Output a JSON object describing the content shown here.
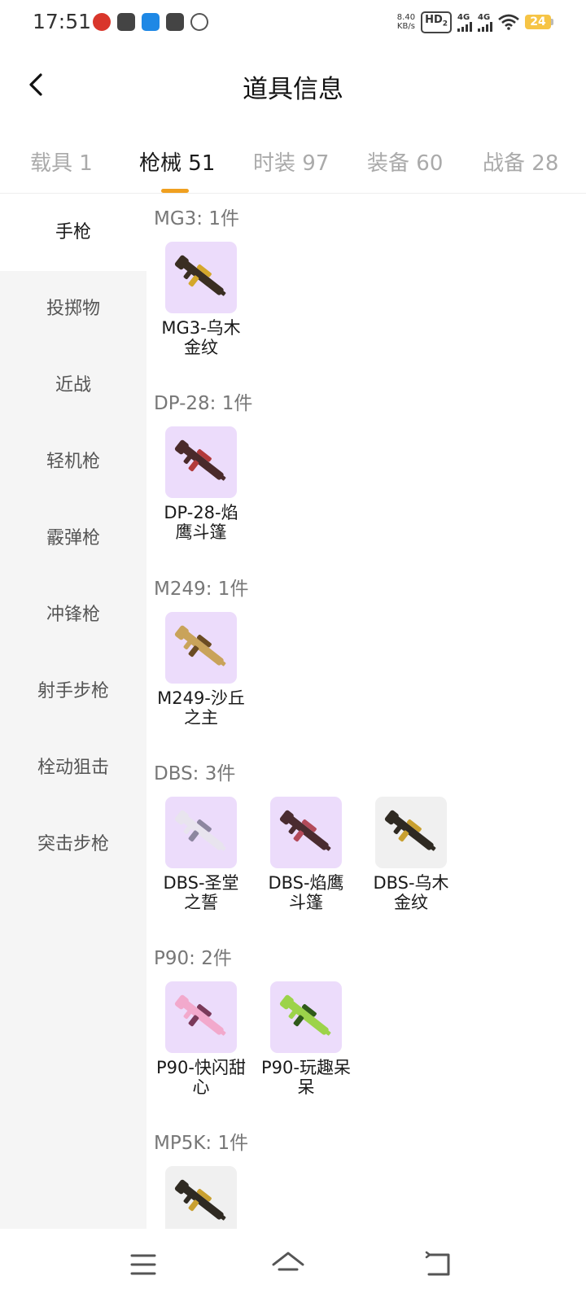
{
  "status_bar": {
    "time": "17:51",
    "net_speed_value": "8.40",
    "net_speed_unit": "KB/s",
    "hd_label": "HD",
    "hd_sub": "2",
    "signal_1_label": "4G",
    "signal_2_label": "4G",
    "battery_level": "24",
    "left_icons": [
      "app-badge-icon",
      "scissors-app-icon",
      "blue-app-icon",
      "mail-box-icon",
      "leaf-icon"
    ],
    "right_icons": [
      "wifi-icon",
      "battery-icon"
    ]
  },
  "header": {
    "title": "道具信息",
    "back_icon": "chevron-left-icon"
  },
  "tabs": [
    {
      "label": "载具",
      "count": "1"
    },
    {
      "label": "枪械",
      "count": "51",
      "active": true
    },
    {
      "label": "时装",
      "count": "97"
    },
    {
      "label": "装备",
      "count": "60"
    },
    {
      "label": "战备",
      "count": "28"
    }
  ],
  "accent_color": "#f0a020",
  "sidebar": {
    "items": [
      {
        "label": "手枪",
        "active": true
      },
      {
        "label": "投掷物"
      },
      {
        "label": "近战"
      },
      {
        "label": "轻机枪"
      },
      {
        "label": "霰弹枪"
      },
      {
        "label": "冲锋枪"
      },
      {
        "label": "射手步枪"
      },
      {
        "label": "栓动狙击"
      },
      {
        "label": "突击步枪"
      }
    ]
  },
  "groups": [
    {
      "title": "MG3: 1件",
      "items": [
        {
          "line1": "MG3-乌木",
          "line2": "金纹",
          "tile_color": "#ecdcfb",
          "icon": "mg3-ebony-gold-gun-icon",
          "gun_color": "#3a2e22",
          "accent": "#d4a72c"
        }
      ]
    },
    {
      "title": "DP-28: 1件",
      "items": [
        {
          "line1": "DP-28-焰",
          "line2": "鹰斗篷",
          "tile_color": "#ecdcfb",
          "icon": "dp28-flame-eagle-gun-icon",
          "gun_color": "#4a2a2a",
          "accent": "#b23a3a"
        }
      ]
    },
    {
      "title": "M249: 1件",
      "items": [
        {
          "line1": "M249-沙丘",
          "line2": "之主",
          "tile_color": "#ecdcfb",
          "icon": "m249-dune-lord-gun-icon",
          "gun_color": "#c9a35a",
          "accent": "#6b4c22"
        }
      ]
    },
    {
      "title": "DBS: 3件",
      "items": [
        {
          "line1": "DBS-圣堂",
          "line2": "之誓",
          "tile_color": "#ecdcfb",
          "icon": "dbs-sanctum-oath-gun-icon",
          "gun_color": "#e8e4ee",
          "accent": "#8d86a0"
        },
        {
          "line1": "DBS-焰鹰",
          "line2": "斗篷",
          "tile_color": "#ecdcfb",
          "icon": "dbs-flame-eagle-gun-icon",
          "gun_color": "#4a2c30",
          "accent": "#b34a5a"
        },
        {
          "line1": "DBS-乌木",
          "line2": "金纹",
          "tile_color": "#f0f0f0",
          "icon": "dbs-ebony-gold-gun-icon",
          "gun_color": "#2f2a22",
          "accent": "#c9a030"
        }
      ]
    },
    {
      "title": "P90: 2件",
      "items": [
        {
          "line1": "P90-快闪甜",
          "line2": "心",
          "tile_color": "#ecdcfb",
          "icon": "p90-flash-sweetheart-gun-icon",
          "gun_color": "#f2a9cc",
          "accent": "#7a3a5a"
        },
        {
          "line1": "P90-玩趣呆",
          "line2": "呆",
          "tile_color": "#ecdcfb",
          "icon": "p90-playful-gun-icon",
          "gun_color": "#9cd34a",
          "accent": "#2f5a1a"
        }
      ]
    },
    {
      "title": "MP5K: 1件",
      "items": [
        {
          "line1": "",
          "line2": "",
          "tile_color": "#f0f0f0",
          "icon": "mp5k-gun-icon",
          "gun_color": "#2f2a22",
          "accent": "#c9a030"
        }
      ]
    }
  ],
  "nav_bar": {
    "icons": [
      "menu-icon",
      "home-icon",
      "back-icon"
    ]
  }
}
